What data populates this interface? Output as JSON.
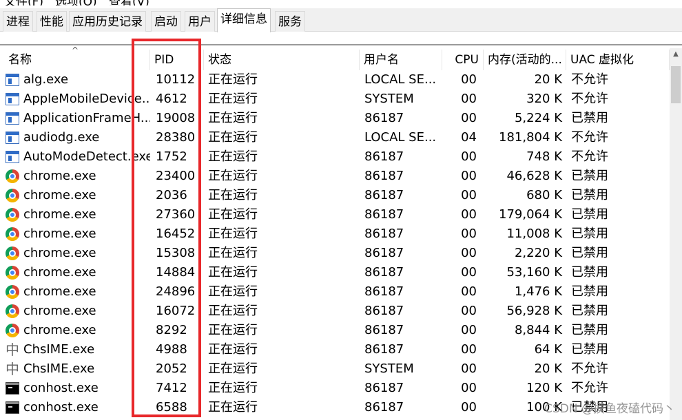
{
  "menu": [
    "文件(F)",
    "选项(O)",
    "查看(V)"
  ],
  "tabs": [
    {
      "label": "进程",
      "active": false
    },
    {
      "label": "性能",
      "active": false
    },
    {
      "label": "应用历史记录",
      "active": false
    },
    {
      "label": "启动",
      "active": false
    },
    {
      "label": "用户",
      "active": false
    },
    {
      "label": "详细信息",
      "active": true
    },
    {
      "label": "服务",
      "active": false
    }
  ],
  "columns": {
    "name": "名称",
    "pid": "PID",
    "status": "状态",
    "user": "用户名",
    "cpu": "CPU",
    "memory": "内存(活动的...",
    "uac": "UAC 虚拟化"
  },
  "rows": [
    {
      "icon": "window-app-icon",
      "name": "alg.exe",
      "pid": "10112",
      "status": "正在运行",
      "user": "LOCAL SE...",
      "cpu": "00",
      "memory": "20 K",
      "uac": "不允许"
    },
    {
      "icon": "window-app-icon",
      "name": "AppleMobileDevice...",
      "pid": "4612",
      "status": "正在运行",
      "user": "SYSTEM",
      "cpu": "00",
      "memory": "320 K",
      "uac": "不允许"
    },
    {
      "icon": "window-app-icon",
      "name": "ApplicationFrameH...",
      "pid": "19008",
      "status": "正在运行",
      "user": "86187",
      "cpu": "00",
      "memory": "5,224 K",
      "uac": "已禁用"
    },
    {
      "icon": "window-app-icon",
      "name": "audiodg.exe",
      "pid": "28380",
      "status": "正在运行",
      "user": "LOCAL SE...",
      "cpu": "04",
      "memory": "181,804 K",
      "uac": "不允许"
    },
    {
      "icon": "window-app-icon",
      "name": "AutoModeDetect.exe",
      "pid": "1752",
      "status": "正在运行",
      "user": "86187",
      "cpu": "00",
      "memory": "748 K",
      "uac": "不允许"
    },
    {
      "icon": "chrome-icon",
      "name": "chrome.exe",
      "pid": "23400",
      "status": "正在运行",
      "user": "86187",
      "cpu": "00",
      "memory": "46,628 K",
      "uac": "已禁用"
    },
    {
      "icon": "chrome-icon",
      "name": "chrome.exe",
      "pid": "2036",
      "status": "正在运行",
      "user": "86187",
      "cpu": "00",
      "memory": "680 K",
      "uac": "已禁用"
    },
    {
      "icon": "chrome-icon",
      "name": "chrome.exe",
      "pid": "27360",
      "status": "正在运行",
      "user": "86187",
      "cpu": "00",
      "memory": "179,064 K",
      "uac": "已禁用"
    },
    {
      "icon": "chrome-icon",
      "name": "chrome.exe",
      "pid": "16452",
      "status": "正在运行",
      "user": "86187",
      "cpu": "00",
      "memory": "11,008 K",
      "uac": "已禁用"
    },
    {
      "icon": "chrome-icon",
      "name": "chrome.exe",
      "pid": "15308",
      "status": "正在运行",
      "user": "86187",
      "cpu": "00",
      "memory": "2,220 K",
      "uac": "已禁用"
    },
    {
      "icon": "chrome-icon",
      "name": "chrome.exe",
      "pid": "14884",
      "status": "正在运行",
      "user": "86187",
      "cpu": "00",
      "memory": "53,160 K",
      "uac": "已禁用"
    },
    {
      "icon": "chrome-icon",
      "name": "chrome.exe",
      "pid": "24896",
      "status": "正在运行",
      "user": "86187",
      "cpu": "00",
      "memory": "1,476 K",
      "uac": "已禁用"
    },
    {
      "icon": "chrome-icon",
      "name": "chrome.exe",
      "pid": "16072",
      "status": "正在运行",
      "user": "86187",
      "cpu": "00",
      "memory": "56,928 K",
      "uac": "已禁用"
    },
    {
      "icon": "chrome-icon",
      "name": "chrome.exe",
      "pid": "8292",
      "status": "正在运行",
      "user": "86187",
      "cpu": "00",
      "memory": "8,844 K",
      "uac": "已禁用"
    },
    {
      "icon": "ime-icon",
      "name": "ChsIME.exe",
      "pid": "4988",
      "status": "正在运行",
      "user": "86187",
      "cpu": "00",
      "memory": "64 K",
      "uac": "已禁用"
    },
    {
      "icon": "ime-icon",
      "name": "ChsIME.exe",
      "pid": "2052",
      "status": "正在运行",
      "user": "SYSTEM",
      "cpu": "00",
      "memory": "20 K",
      "uac": "不允许"
    },
    {
      "icon": "console-icon",
      "name": "conhost.exe",
      "pid": "7412",
      "status": "正在运行",
      "user": "86187",
      "cpu": "00",
      "memory": "120 K",
      "uac": "不允许"
    },
    {
      "icon": "console-icon",
      "name": "conhost.exe",
      "pid": "6588",
      "status": "正在运行",
      "user": "86187",
      "cpu": "00",
      "memory": "100 K",
      "uac": "已禁用"
    }
  ],
  "watermark": "CSDN @摸鱼夜磕代码丶",
  "colors": {
    "highlight": "#e8282b",
    "accent": "#2f6cc7"
  }
}
